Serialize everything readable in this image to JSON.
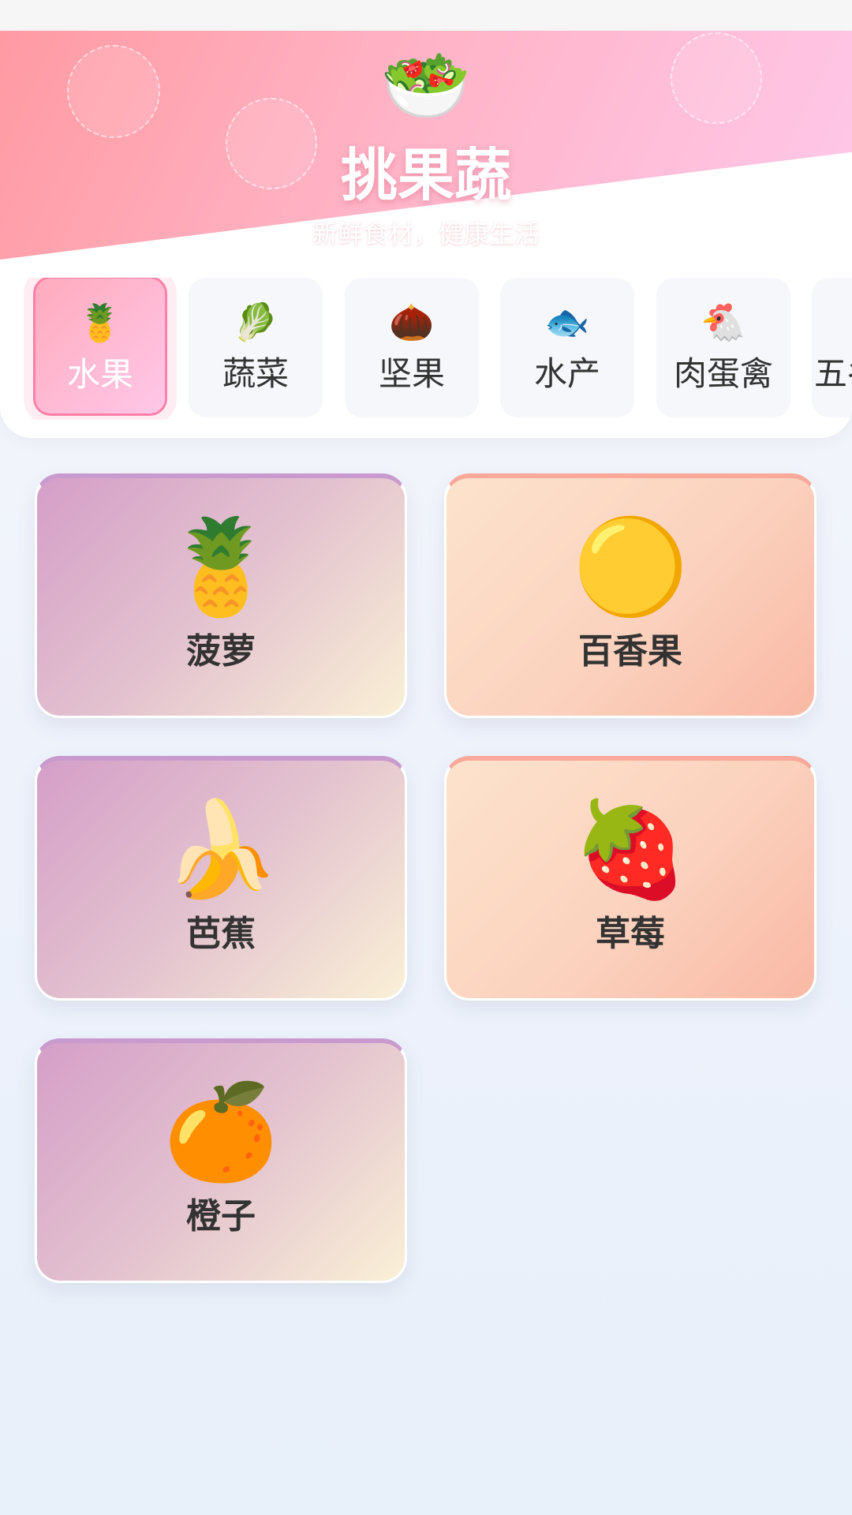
{
  "header": {
    "icon": "🥗",
    "title": "挑果蔬",
    "subtitle": "新鲜食材，健康生活"
  },
  "tabs": [
    {
      "icon": "🍍",
      "label": "水果",
      "selected": true
    },
    {
      "icon": "🥬",
      "label": "蔬菜",
      "selected": false
    },
    {
      "icon": "🌰",
      "label": "坚果",
      "selected": false
    },
    {
      "icon": "🐟",
      "label": "水产",
      "selected": false
    },
    {
      "icon": "🐔",
      "label": "肉蛋禽",
      "selected": false
    },
    {
      "icon": "",
      "label": "五谷",
      "selected": false
    }
  ],
  "products": [
    {
      "icon": "🍍",
      "name": "菠萝"
    },
    {
      "icon": "🟡",
      "name": "百香果"
    },
    {
      "icon": "🍌",
      "name": "芭蕉"
    },
    {
      "icon": "🍓",
      "name": "草莓"
    },
    {
      "icon": "🍊",
      "name": "橙子"
    }
  ],
  "colors": {
    "accent": "#ff7fa7",
    "hero_start": "#ff9aa2",
    "hero_end": "#ffc8ea",
    "text": "#333333"
  }
}
